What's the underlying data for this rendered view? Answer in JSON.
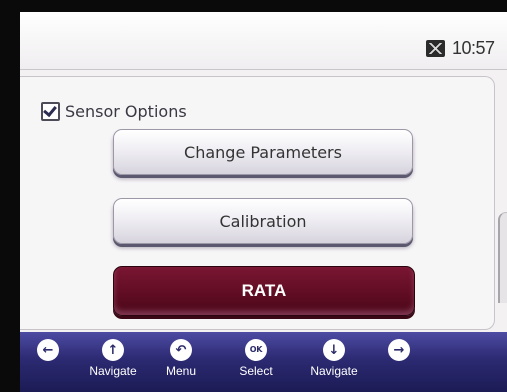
{
  "status_bar": {
    "status_icon": "display-off-icon",
    "time": "10:57"
  },
  "section": {
    "checkbox_checked": true,
    "label": "Sensor Options"
  },
  "menu": {
    "items": [
      {
        "label": "Change Parameters",
        "selected": false
      },
      {
        "label": "Calibration",
        "selected": false
      },
      {
        "label": "RATA",
        "selected": true
      }
    ]
  },
  "softkeys": [
    {
      "icon": "arrow-left-icon",
      "glyph": "←",
      "label": ""
    },
    {
      "icon": "arrow-up-icon",
      "glyph": "↑",
      "label": "Navigate"
    },
    {
      "icon": "menu-back-icon",
      "glyph": "↶",
      "label": "Menu"
    },
    {
      "icon": "ok-icon",
      "glyph": "OK",
      "label": "Select"
    },
    {
      "icon": "arrow-down-icon",
      "glyph": "↓",
      "label": "Navigate"
    },
    {
      "icon": "arrow-right-icon",
      "glyph": "→",
      "label": ""
    }
  ],
  "colors": {
    "selected_button": "#5e0c22",
    "softkey_bar": "#2c2a72"
  }
}
